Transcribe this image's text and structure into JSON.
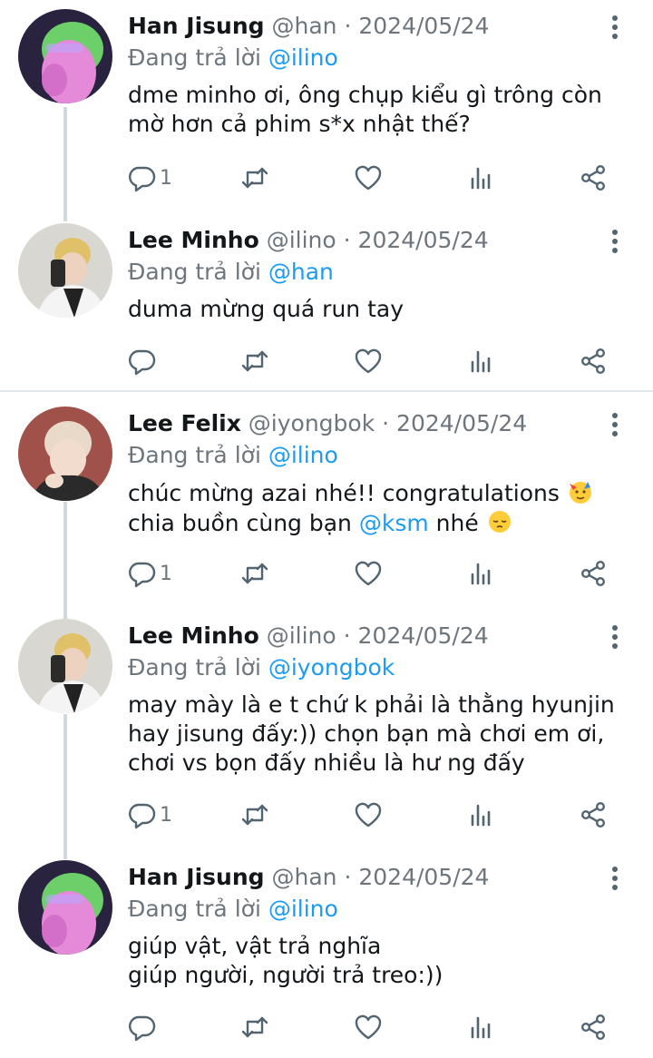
{
  "tweets": [
    {
      "name": "Han Jisung",
      "handle": "@han",
      "sep": " · ",
      "date": "2024/05/24",
      "reply_prefix": "Đang trả lời ",
      "reply_to": "@ilino",
      "lines": [
        "dme minho ơi, ông chụp kiểu gì trông còn",
        "mờ hơn cả phim s*x nhật thế?"
      ],
      "reply_count": "1",
      "avatar": "avatar-han"
    },
    {
      "name": "Lee Minho",
      "handle": "@ilino",
      "sep": " · ",
      "date": "2024/05/24",
      "reply_prefix": "Đang trả lời ",
      "reply_to": "@han",
      "lines": [
        "duma mừng quá run tay"
      ],
      "reply_count": "",
      "avatar": "avatar-minho"
    },
    {
      "name": "Lee Felix",
      "handle": "@iyongbok",
      "sep": " · ",
      "date": "2024/05/24",
      "reply_prefix": "Đang trả lời ",
      "reply_to": "@ilino",
      "line1": "chúc mừng azai nhé!! congratulations ",
      "line2_prefix": "chia buồn cùng bạn ",
      "line2_mention": "@ksm",
      "line2_suffix": " nhé ",
      "reply_count": "1",
      "avatar": "avatar-felix"
    },
    {
      "name": "Lee Minho",
      "handle": "@ilino",
      "sep": " · ",
      "date": "2024/05/24",
      "reply_prefix": "Đang trả lời ",
      "reply_to": "@iyongbok",
      "lines": [
        "may mày là e t chứ k phải là thằng hyunjin",
        "hay jisung đấy:)) chọn bạn mà chơi em ơi,",
        "chơi vs bọn đấy nhiều là hư ng đấy"
      ],
      "reply_count": "1",
      "avatar": "avatar-minho"
    },
    {
      "name": "Han Jisung",
      "handle": "@han",
      "sep": " · ",
      "date": "2024/05/24",
      "reply_prefix": "Đang trả lời ",
      "reply_to": "@ilino",
      "lines": [
        "giúp vật, vật trả nghĩa",
        "giúp người, người trả treo:))"
      ],
      "reply_count": "",
      "avatar": "avatar-han"
    }
  ],
  "icons": [
    "reply-icon",
    "retweet-icon",
    "like-icon",
    "views-icon",
    "share-icon",
    "more-icon"
  ],
  "colors": {
    "mention": "#1d9bf0",
    "muted": "#6e767d",
    "thread_line": "#cfd9de",
    "icon": "#536471"
  }
}
